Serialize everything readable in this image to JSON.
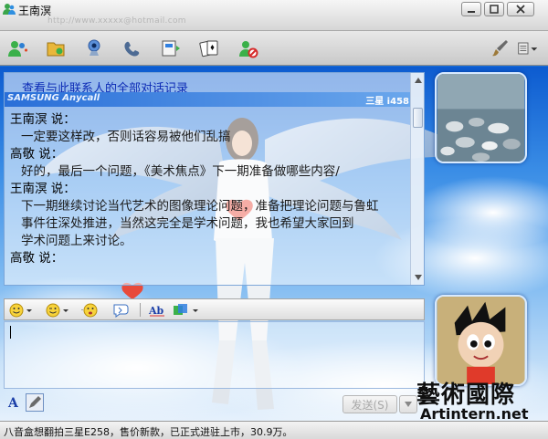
{
  "window": {
    "title": "王南溟",
    "email_hint": "http://www.xxxxx@hotmail.com"
  },
  "history": {
    "link": "查看与此联系人的全部对话记录",
    "brand_left": "SAMSUNG Anycall",
    "brand_right": "三星 i458",
    "messages": [
      {
        "sender": "王南溟 说：",
        "lines": [
          "一定要这样改，否则话容易被他们乱搞"
        ]
      },
      {
        "sender": "高敬 说：",
        "lines": [
          "好的，最后一个问题，《美术焦点》下一期准备做哪些内容/"
        ]
      },
      {
        "sender": "王南溟 说：",
        "lines": [
          "下一期继续讨论当代艺术的图像理论问题，准备把理论问题与鲁虹",
          "事件往深处推进，当然这完全是学术问题，我也希望大家回到",
          "学术问题上来讨论。"
        ]
      },
      {
        "sender": "高敬 说：",
        "lines": []
      }
    ]
  },
  "input": {
    "send_label": "发送(S)"
  },
  "watermark": {
    "cn": "藝術國際",
    "en": "Artintern.net"
  },
  "status": {
    "text": "八音盒想翻拍三星E258，售价新款，已正式进驻上市，30.9万。"
  },
  "colors": {
    "link": "#0b2ab5",
    "sky": "#3b8ee6"
  }
}
